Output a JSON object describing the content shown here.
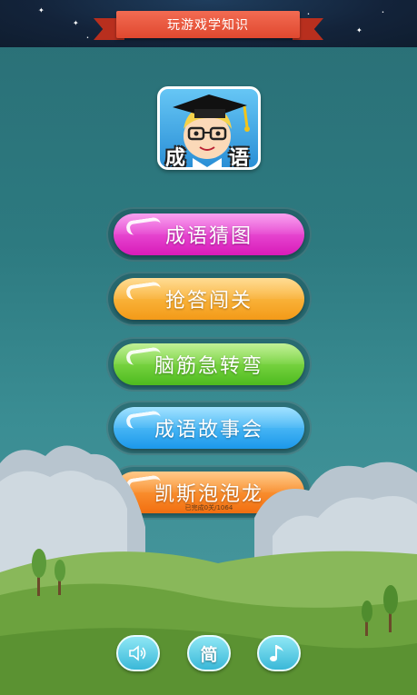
{
  "header": {
    "title": "玩游戏学知识"
  },
  "logo": {
    "char1": "成",
    "char2": "语"
  },
  "menu": [
    {
      "label": "成语猜图",
      "color": "#e63ad0"
    },
    {
      "label": "抢答闯关",
      "color": "#f7ad2b"
    },
    {
      "label": "脑筋急转弯",
      "color": "#6fd236"
    },
    {
      "label": "成语故事会",
      "color": "#2ba9f0"
    },
    {
      "label": "凯斯泡泡龙",
      "color": "#f58623"
    }
  ],
  "progress_text": "已完成0关/1064",
  "controls": {
    "sound_icon": "speaker-icon",
    "language_label": "简",
    "music_icon": "music-note-icon"
  }
}
